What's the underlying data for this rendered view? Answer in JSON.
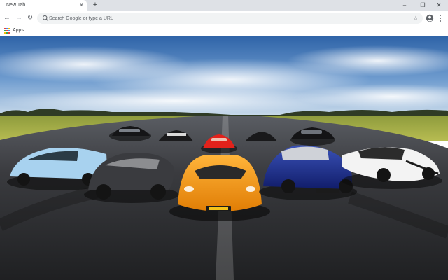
{
  "browser": {
    "tab": {
      "title": "New Tab",
      "close_icon": "close-icon"
    },
    "new_tab_icon": "plus-icon",
    "window_controls": {
      "minimize": "minimize-icon",
      "restore": "restore-icon",
      "close": "close-icon"
    },
    "toolbar": {
      "back_icon": "arrow-left-icon",
      "forward_icon": "arrow-right-icon",
      "reload_icon": "reload-icon",
      "omnibox": {
        "value": "",
        "placeholder": "Search Google or type a URL",
        "search_icon": "google-g-icon"
      },
      "bookmark_icon": "star-icon",
      "account_icon": "account-circle-icon",
      "menu_icon": "kebab-menu-icon"
    },
    "bookmarks_bar": {
      "apps_label": "Apps",
      "apps_icon": "apps-grid-icon"
    }
  },
  "wallpaper": {
    "subject": "supercars lined up on an airfield runway",
    "colors": {
      "sky": "#4a7fbf",
      "grass": "#a9b43c",
      "asphalt": "#2b2c2e",
      "front_car": "#f39a0c"
    }
  }
}
